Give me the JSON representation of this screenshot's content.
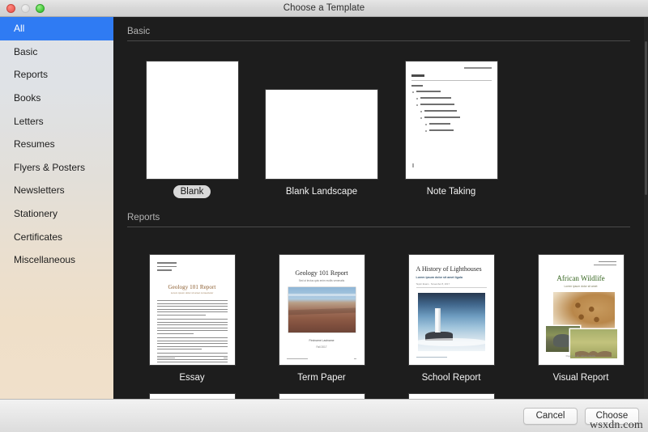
{
  "window": {
    "title": "Choose a Template",
    "traffic_lights": [
      "close",
      "minimize",
      "zoom"
    ]
  },
  "sidebar": {
    "items": [
      {
        "label": "All",
        "selected": true
      },
      {
        "label": "Basic",
        "selected": false
      },
      {
        "label": "Reports",
        "selected": false
      },
      {
        "label": "Books",
        "selected": false
      },
      {
        "label": "Letters",
        "selected": false
      },
      {
        "label": "Resumes",
        "selected": false
      },
      {
        "label": "Flyers & Posters",
        "selected": false
      },
      {
        "label": "Newsletters",
        "selected": false
      },
      {
        "label": "Stationery",
        "selected": false
      },
      {
        "label": "Certificates",
        "selected": false
      },
      {
        "label": "Miscellaneous",
        "selected": false
      }
    ]
  },
  "sections": [
    {
      "heading": "Basic",
      "templates": [
        {
          "name": "Blank",
          "selected": true,
          "orientation": "portrait"
        },
        {
          "name": "Blank Landscape",
          "selected": false,
          "orientation": "landscape"
        },
        {
          "name": "Note Taking",
          "selected": false,
          "orientation": "portrait"
        }
      ]
    },
    {
      "heading": "Reports",
      "templates": [
        {
          "name": "Essay",
          "selected": false,
          "orientation": "portrait"
        },
        {
          "name": "Term Paper",
          "selected": false,
          "orientation": "portrait"
        },
        {
          "name": "School Report",
          "selected": false,
          "orientation": "portrait"
        },
        {
          "name": "Visual Report",
          "selected": false,
          "orientation": "portrait"
        }
      ]
    }
  ],
  "thumbnail_text": {
    "essay_title": "Geology 101 Report",
    "essay_subtitle": "Lorem ipsum dolor sit amet consectetur",
    "term_paper_title": "Geology 101 Report",
    "term_paper_subtitle": "Sed ut lectus quis enim mollis venenatis",
    "term_paper_author": "Firstname Lastname",
    "term_paper_date": "Fall 2017",
    "school_report_title": "A History of Lighthouses",
    "school_report_subtitle": "Lorem ipsum dolor sit amet ligula",
    "school_report_byline": "Taylor Evans  ·  November 8, 2017",
    "visual_report_title": "African Wildlife",
    "visual_report_subtitle": "Lorem ipsum dolor sit amet",
    "visual_report_footer": "Page 1 of 12  ·  African Wildlife"
  },
  "footer": {
    "cancel_label": "Cancel",
    "choose_label": "Choose"
  },
  "watermark": "wsxdn.com",
  "colors": {
    "selection_blue": "#2f7bf3",
    "panel_dark": "#1d1d1d",
    "sidebar_top": "#dfe3e8",
    "sidebar_bottom": "#f0e0cb",
    "essay_title": "#8a5a2b",
    "visual_title": "#35651f"
  }
}
